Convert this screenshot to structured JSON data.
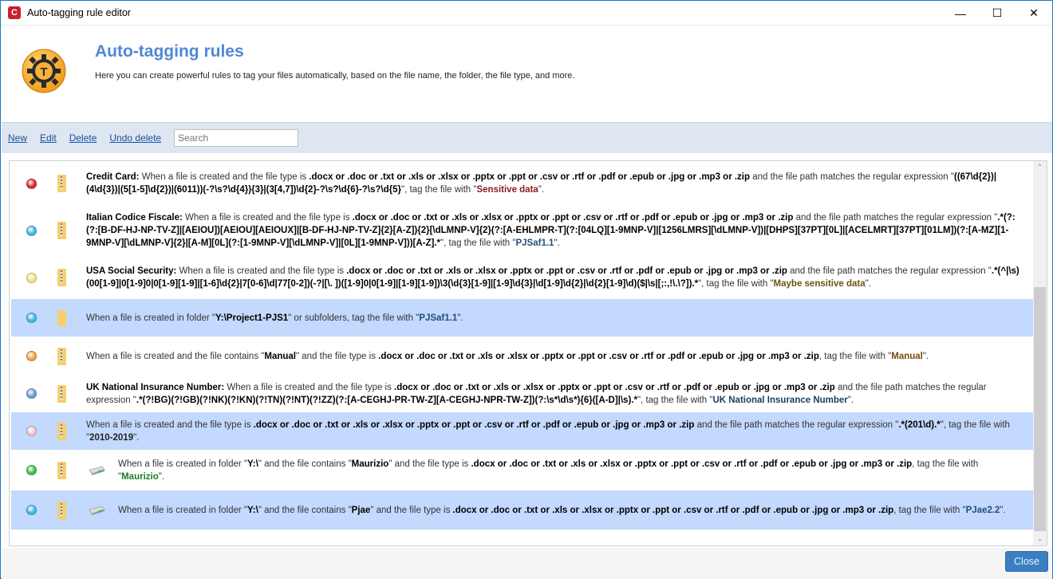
{
  "window": {
    "title": "Auto-tagging rule editor",
    "app_icon_letter": "C",
    "controls": {
      "minimize": "—",
      "maximize": "☐",
      "close": "✕"
    }
  },
  "header": {
    "title": "Auto-tagging rules",
    "subtitle": "Here you can create powerful rules to tag your files automatically, based on the file name, the folder, the file type, and more.",
    "logo_icon": "gear-t-icon"
  },
  "toolbar": {
    "new_label": "New",
    "edit_label": "Edit",
    "delete_label": "Delete",
    "undo_delete_label": "Undo delete",
    "search_placeholder": "Search",
    "search_value": ""
  },
  "colors": {
    "accent": "#4f88d6",
    "selected_row": "#c3d9fd",
    "toolbar_bg": "#dde6f1",
    "close_button": "#3a7fc1"
  },
  "rules": [
    {
      "selected": false,
      "dot_color": "#e0232a",
      "icons": [
        "zip"
      ],
      "name": "Credit Card:",
      "pre": " When a file is created  and the file type is ",
      "types": ".docx or .doc or .txt or .xls or .xlsx or .pptx or .ppt or .csv or .rtf or .pdf or .epub or .jpg or .mp3 or .zip",
      "mid": " and the file path matches the regular expression \"",
      "regex": "((67\\d{2})|(4\\d{3})|(5[1-5]\\d{2})|(6011))(-?\\s?\\d{4}){3}|(3[4,7])\\d{2}-?\\s?\\d{6}-?\\s?\\d{5}",
      "post": "\", tag the file with  \"",
      "tag": "Sensitive data",
      "tag_color": "#8b1a1a",
      "end": "\"."
    },
    {
      "selected": false,
      "dot_color": "#3db8ea",
      "icons": [
        "zip"
      ],
      "name": "Italian Codice Fiscale:",
      "pre": " When a file is created  and the file type is ",
      "types": ".docx or .doc or .txt or .xls or .xlsx or .pptx or .ppt or .csv or .rtf or .pdf or .epub or .jpg or .mp3 or .zip",
      "mid": " and the file path matches the regular expression \"",
      "regex": ".*(?:(?:[B-DF-HJ-NP-TV-Z]|[AEIOU])[AEIOU][AEIOUX]|[B-DF-HJ-NP-TV-Z]{2}[A-Z]){2}[\\dLMNP-V]{2}(?:[A-EHLMPR-T](?:[04LQ][1-9MNP-V]|[1256LMRS][\\dLMNP-V])|[DHPS][37PT][0L]|[ACELMRT][37PT][01LM])(?:[A-MZ][1-9MNP-V][\\dLMNP-V]{2}|[A-M][0L](?:[1-9MNP-V][\\dLMNP-V]|[0L][1-9MNP-V]))[A-Z].*",
      "post": "\", tag the file with  \"",
      "tag": "PJSaf1.1",
      "tag_color": "#1d4f7a",
      "end": "\"."
    },
    {
      "selected": false,
      "dot_color": "#f3e47a",
      "icons": [
        "zip"
      ],
      "name": "USA  Social Security:",
      "pre": " When a file is created  and the file type is ",
      "types": ".docx or .doc or .txt or .xls or .xlsx or .pptx or .ppt or .csv or .rtf or .pdf or .epub or .jpg or .mp3 or .zip",
      "mid": " and the file path matches the regular expression \"",
      "regex": ".*(^|\\s)(00[1-9]|0[1-9]0|0[1-9][1-9]|[1-6]\\d{2}|7[0-6]\\d|77[0-2])(-?|[\\. ])([1-9]0|0[1-9]|[1-9][1-9])\\3(\\d{3}[1-9]|[1-9]\\d{3}|\\d[1-9]\\d{2}|\\d{2}[1-9]\\d)($|\\s|[;:,!\\.\\?]).*",
      "post": "\", tag the file with  \"",
      "tag": "Maybe sensitive data",
      "tag_color": "#6b5410",
      "end": "\"."
    },
    {
      "selected": true,
      "dot_color": "#3db8ea",
      "icons": [
        "folder"
      ],
      "name": "",
      "pre": "When a file is created in folder \"",
      "types": "Y:\\Project1-PJS1",
      "mid": "\" or subfolders, tag the file with  \"",
      "regex": "",
      "post": "",
      "tag": "PJSaf1.1",
      "tag_color": "#1d4f7a",
      "end": "\"."
    },
    {
      "selected": false,
      "dot_color": "#f0a23a",
      "icons": [
        "zip"
      ],
      "name": "",
      "pre": "When a file is created  and the file contains \"",
      "contains": "Manual",
      "pre2": "\" and the file type is ",
      "types": ".docx or .doc or .txt or .xls or .xlsx or .pptx or .ppt or .csv or .rtf or .pdf or .epub or .jpg or .mp3 or .zip",
      "mid": ", tag the file with  \"",
      "regex": "",
      "post": "",
      "tag": "Manual",
      "tag_color": "#7a4a10",
      "end": "\"."
    },
    {
      "selected": false,
      "dot_color": "#6f9bd1",
      "icons": [
        "zip"
      ],
      "name": "UK National Insurance Number:",
      "pre": " When a file is created  and the file type is ",
      "types": ".docx or .doc or .txt or .xls or .xlsx or .pptx or .ppt or .csv or .rtf or .pdf or .epub or .jpg or .mp3 or .zip",
      "mid": " and the file path matches the regular expression \"",
      "regex": ".*(?!BG)(?!GB)(?!NK)(?!KN)(?!TN)(?!NT)(?!ZZ)(?:[A-CEGHJ-PR-TW-Z][A-CEGHJ-NPR-TW-Z])(?:\\s*\\d\\s*){6}([A-D]|\\s).*",
      "post": "\", tag the file with  \"",
      "tag": "UK National Insurance Number",
      "tag_color": "#1d3f66",
      "end": "\"."
    },
    {
      "selected": true,
      "dot_color": "#f2c3cf",
      "icons": [
        "zip"
      ],
      "name": "",
      "pre": "When a file is created  and the file type is ",
      "types": ".docx or .doc or .txt or .xls or .xlsx or .pptx or .ppt or .csv or .rtf or .pdf or .epub or .jpg or .mp3 or .zip",
      "mid": " and the file path matches the regular expression \"",
      "regex": ".*(201\\d).*",
      "post": "\", tag the file with  \"",
      "tag": "2010-2019",
      "tag_color": "#222222",
      "end": "\"."
    },
    {
      "selected": false,
      "dot_color": "#3cc04a",
      "icons": [
        "zip",
        "drive"
      ],
      "name": "",
      "pre": "When a file is created in folder \"",
      "folder": "Y:\\",
      "pre2": "\" and the file contains \"",
      "contains": "Maurizio",
      "pre3": "\" and the file type is ",
      "types": ".docx or .doc or .txt or .xls or .xlsx or .pptx or .ppt or .csv or .rtf or .pdf or .epub or .jpg or .mp3 or .zip",
      "mid": ", tag the file with  \"",
      "regex": "",
      "post": "",
      "tag": "Maurizio",
      "tag_color": "#1f7a2a",
      "end": "\"."
    },
    {
      "selected": true,
      "dot_color": "#3db8ea",
      "icons": [
        "zip",
        "drive"
      ],
      "name": "",
      "pre": "When a file is created in folder \"",
      "folder": "Y:\\",
      "pre2": "\" and the file contains \"",
      "contains": "Pjae",
      "pre3": "\" and the file type is ",
      "types": ".docx or .doc or .txt or .xls or .xlsx or .pptx or .ppt or .csv or .rtf or .pdf or .epub or .jpg or .mp3 or .zip",
      "mid": ", tag the file with  \"",
      "regex": "",
      "post": "",
      "tag": "PJae2.2",
      "tag_color": "#1d4f7a",
      "end": "\"."
    }
  ],
  "scrollbar": {
    "up_icon": "⌃",
    "down_icon": "⌄",
    "position_fraction": 0.33
  },
  "footer": {
    "close_label": "Close"
  }
}
